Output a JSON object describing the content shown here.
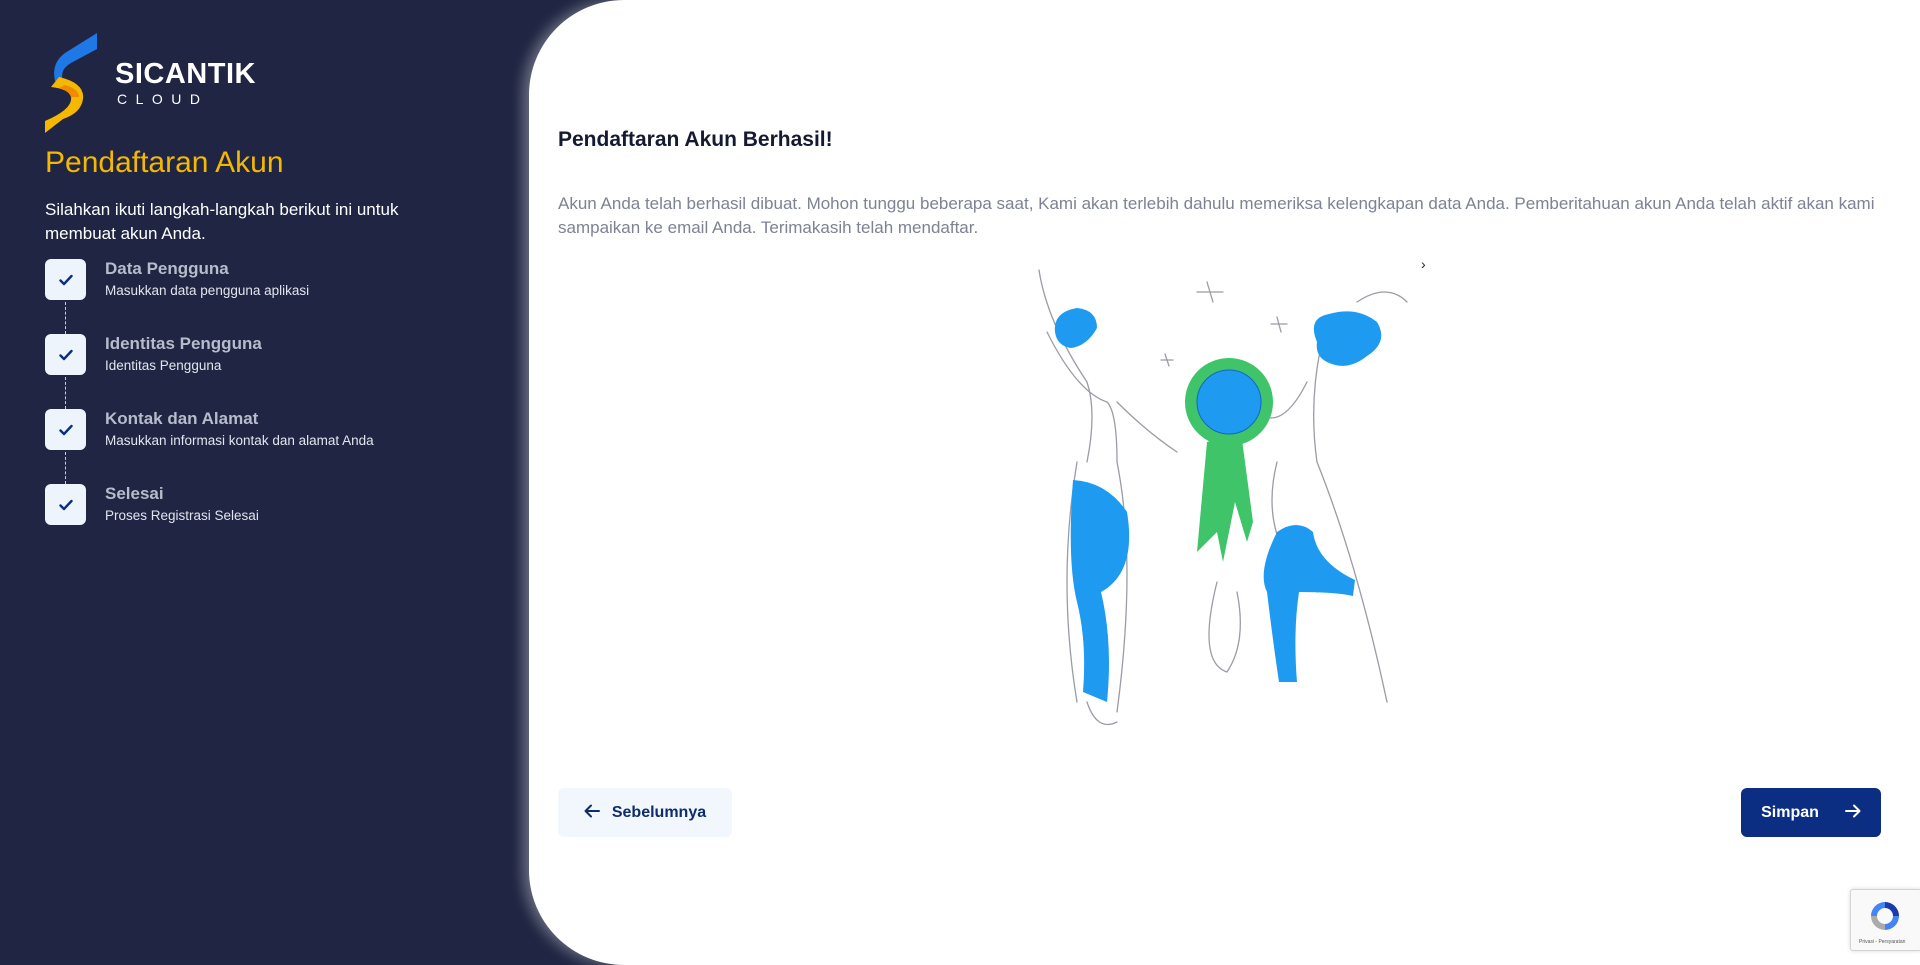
{
  "brand": {
    "name": "SICANTIK",
    "sub": "CLOUD"
  },
  "sidebar": {
    "title": "Pendaftaran Akun",
    "description": "Silahkan ikuti langkah-langkah berikut ini untuk membuat akun Anda.",
    "steps": [
      {
        "title": "Data Pengguna",
        "subtitle": "Masukkan data pengguna aplikasi",
        "done": true
      },
      {
        "title": "Identitas Pengguna",
        "subtitle": "Identitas Pengguna",
        "done": true
      },
      {
        "title": "Kontak dan Alamat",
        "subtitle": "Masukkan informasi kontak dan alamat Anda",
        "done": true
      },
      {
        "title": "Selesai",
        "subtitle": "Proses Registrasi Selesai",
        "done": true
      }
    ]
  },
  "main": {
    "title": "Pendaftaran Akun Berhasil!",
    "description": "Akun Anda telah berhasil dibuat. Mohon tunggu beberapa saat, Kami akan terlebih dahulu memeriksa kelengkapan data Anda. Pemberitahuan akun Anda telah aktif akan kami sampaikan ke email Anda. Terimakasih telah mendaftar.",
    "chevron": "›",
    "prev_label": "Sebelumnya",
    "next_label": "Simpan"
  },
  "recaptcha": {
    "links": "Privasi - Persyaratan"
  },
  "colors": {
    "sidebar_bg": "#1f2542",
    "accent_yellow": "#f5b800",
    "primary_blue": "#0b2e82",
    "illustration_blue": "#1e9bf0",
    "illustration_green": "#3fc46a"
  }
}
